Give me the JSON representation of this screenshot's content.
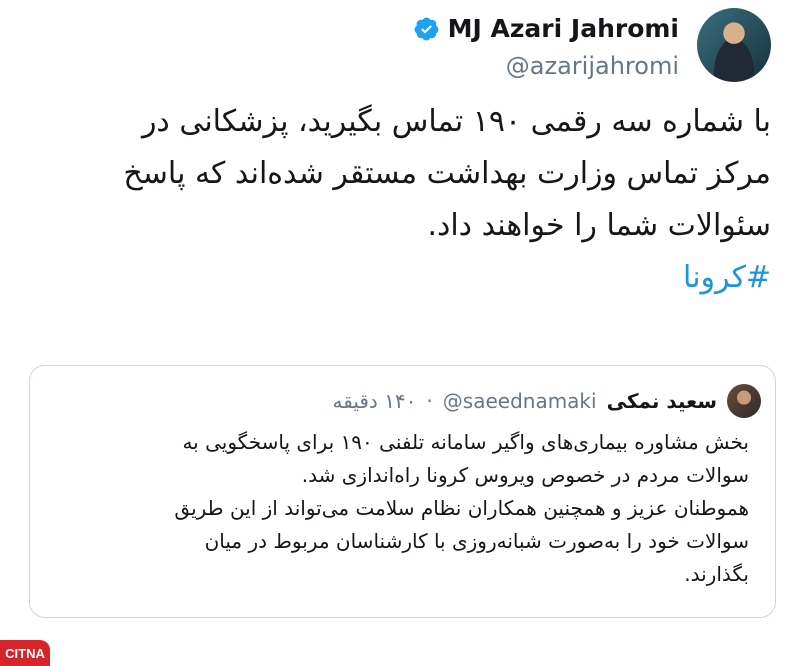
{
  "tweet": {
    "author_name": "MJ Azari Jahromi",
    "handle": "@azarijahromi",
    "text_lines": [
      "با شماره سه رقمی ۱۹۰ تماس بگیرید، پزشکانی در",
      "مرکز تماس وزارت بهداشت مستقر شده‌اند که پاسخ",
      "سئوالات شما را خواهند داد."
    ],
    "hashtag": "#کرونا"
  },
  "quoted_tweet": {
    "author_name": "سعید نمکی",
    "handle": "@saeednamaki",
    "separator": "·",
    "time": "۱۴۰ دقیقه",
    "text_lines": [
      "بخش مشاوره بیماری‌های واگیر سامانه تلفنی ۱۹۰ برای پاسخگویی به",
      "سوالات مردم در خصوص ویروس کرونا راه‌اندازی شد.",
      "هموطنان عزیز و همچنین همکاران نظام سلامت می‌تواند از این طریق",
      "سوالات خود را به‌صورت شبانه‌روزی با کارشناسان مربوط در میان",
      "بگذارند."
    ]
  },
  "watermark": {
    "logo_text": "CITNA"
  },
  "colors": {
    "link": "#1b95e0",
    "verified": "#1da1f2",
    "muted": "#657786",
    "logo_bg": "#d6242b"
  },
  "icons": {
    "verified": "verified-badge-icon"
  }
}
